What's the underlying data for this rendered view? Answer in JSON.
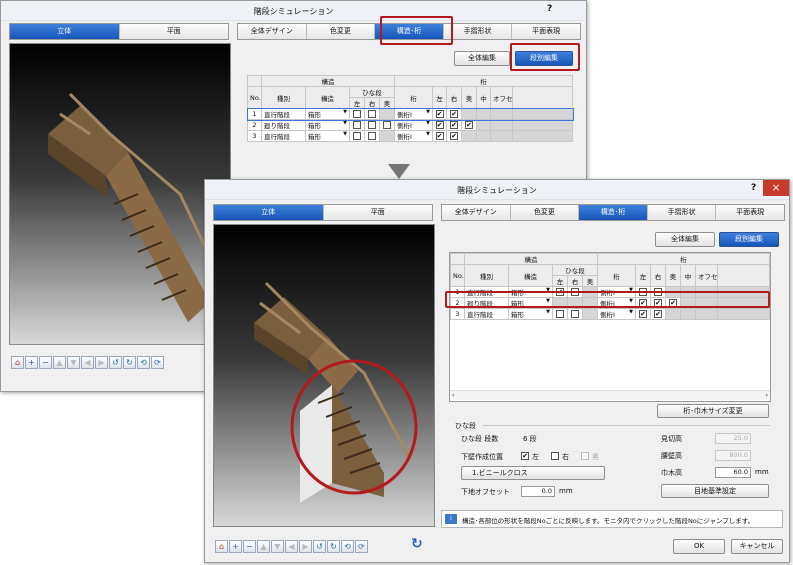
{
  "dialog_title": "階段シミュレーション",
  "help_glyph": "?",
  "close_glyph": "×",
  "view_tabs": [
    "立体",
    "平面"
  ],
  "edit_tabs": [
    "全体デザイン",
    "色変更",
    "構造･桁",
    "手摺形状",
    "平面表現"
  ],
  "mode_buttons": {
    "overall": "全体編集",
    "per_step": "段別編集"
  },
  "table": {
    "group_struct": "構造",
    "group_stringer": "桁",
    "sub_hina": "ひな段",
    "col_no": "No.",
    "col_type": "種別",
    "col_struct": "構造",
    "col_left": "左",
    "col_right": "右",
    "col_back": "奥",
    "col_stringer": "桁",
    "col_center": "中",
    "col_offset": "オフセ",
    "rows": [
      {
        "no": "1",
        "type": "直行階段",
        "struct": "箱形",
        "stringer": "側桁I"
      },
      {
        "no": "2",
        "type": "廻り階段",
        "struct": "箱形",
        "stringer": "側桁I"
      },
      {
        "no": "3",
        "type": "直行階段",
        "struct": "箱形",
        "stringer": "側桁I"
      }
    ]
  },
  "change_size_button": "桁･巾木サイズ変更",
  "hina_section": {
    "title": "ひな段",
    "count_label": "ひな段 段数",
    "count_value": "6 段",
    "wall_label": "下壁作成位置",
    "opt_left": "左",
    "opt_right": "右",
    "opt_back": "奥",
    "material_button": "1.ビニールクロス",
    "offset_label": "下地オフセット",
    "offset_value": "0.0",
    "offset_unit": "mm",
    "mikiri_label": "見切高",
    "mikiri_value": "25.0",
    "koshi_label": "腰壁高",
    "koshi_value": "800.0",
    "habaki_label": "巾木高",
    "habaki_value": "60.0",
    "habaki_unit": "mm",
    "ground_button": "目地基準設定"
  },
  "info_text": "構造･各部位の形状を階段Noごとに反映します。モニタ内でクリックした階段Noにジャンプします。",
  "ok_button": "OK",
  "cancel_button": "キャンセル",
  "refresh_glyph": "↻"
}
